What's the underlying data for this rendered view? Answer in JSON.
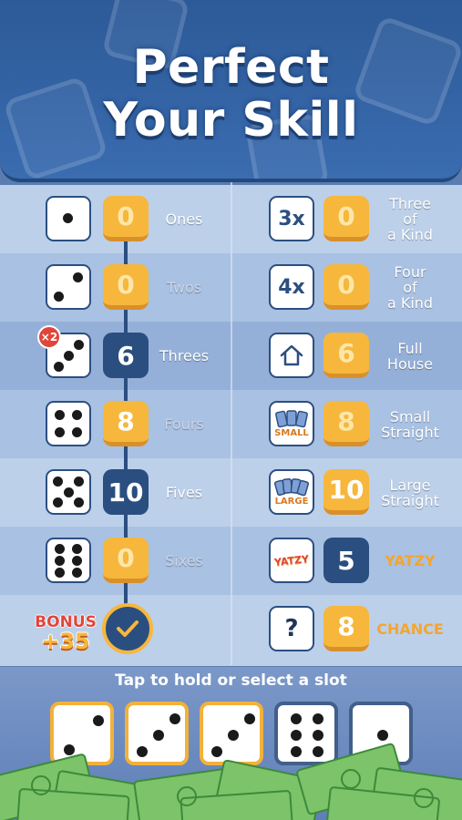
{
  "header": {
    "title_line1": "Perfect",
    "title_line2": "Your Skill"
  },
  "upper": [
    {
      "name": "ones",
      "label": "Ones",
      "score": "0",
      "state": "open"
    },
    {
      "name": "twos",
      "label": "Twos",
      "score": "0",
      "state": "open"
    },
    {
      "name": "threes",
      "label": "Threes",
      "score": "6",
      "state": "filled",
      "badge": "×2"
    },
    {
      "name": "fours",
      "label": "Fours",
      "score": "8",
      "state": "open"
    },
    {
      "name": "fives",
      "label": "Fives",
      "score": "10",
      "state": "filled"
    },
    {
      "name": "sixes",
      "label": "Sixes",
      "score": "0",
      "state": "open"
    }
  ],
  "bonus": {
    "label": "BONUS",
    "value": "+35"
  },
  "lower": [
    {
      "name": "three-of-a-kind",
      "icon_text": "3x",
      "label_lines": [
        "Three",
        "of",
        "a Kind"
      ],
      "score": "0",
      "state": "open"
    },
    {
      "name": "four-of-a-kind",
      "icon_text": "4x",
      "label_lines": [
        "Four",
        "of",
        "a Kind"
      ],
      "score": "0",
      "state": "open"
    },
    {
      "name": "full-house",
      "icon": "house-icon",
      "label_lines": [
        "Full",
        "House"
      ],
      "score": "6",
      "state": "open"
    },
    {
      "name": "small-straight",
      "icon": "cards-icon",
      "icon_text": "SMALL",
      "label_lines": [
        "Small",
        "Straight"
      ],
      "score": "8",
      "state": "open"
    },
    {
      "name": "large-straight",
      "icon": "cards-icon",
      "icon_text": "LARGE",
      "label_lines": [
        "Large",
        "Straight"
      ],
      "score": "10",
      "state": "open"
    },
    {
      "name": "yatzy",
      "icon": "yatzy-logo-icon",
      "icon_text": "YATZY",
      "label_lines": [
        "YATZY"
      ],
      "score": "5",
      "state": "filled"
    },
    {
      "name": "chance",
      "icon_text": "?",
      "label_lines": [
        "CHANCE"
      ],
      "score": "8",
      "state": "open"
    }
  ],
  "hint": "Tap to hold or select a slot",
  "roll": [
    {
      "value": 2,
      "held": true
    },
    {
      "value": 3,
      "held": true
    },
    {
      "value": 3,
      "held": true
    },
    {
      "value": 6,
      "held": false
    },
    {
      "value": 1,
      "held": false
    }
  ],
  "colors": {
    "open_slot": "#f6b73c",
    "filled_slot": "#2b4e80",
    "badge": "#e0453a",
    "accent_orange": "#f4a52e"
  }
}
